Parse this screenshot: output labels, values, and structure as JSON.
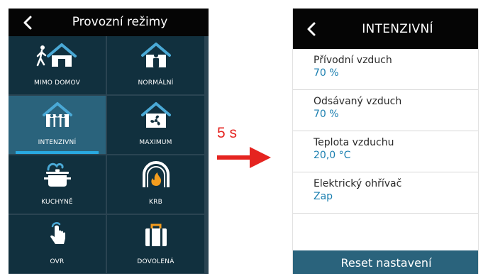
{
  "left_screen": {
    "title": "Provozní režimy",
    "modes": [
      {
        "label": "MIMO DOMOV",
        "icon": "away-from-home-icon"
      },
      {
        "label": "NORMÁLNÍ",
        "icon": "normal-home-icon"
      },
      {
        "label": "INTENZIVNÍ",
        "icon": "intensive-family-icon",
        "selected": true
      },
      {
        "label": "MAXIMUM",
        "icon": "maximum-fan-icon"
      },
      {
        "label": "KUCHYNĚ",
        "icon": "kitchen-pot-icon"
      },
      {
        "label": "KRB",
        "icon": "fireplace-flame-icon"
      },
      {
        "label": "OVR",
        "icon": "touch-hand-icon"
      },
      {
        "label": "DOVOLENÁ",
        "icon": "suitcase-icon"
      }
    ]
  },
  "transition": {
    "delay_label": "5 s",
    "arrow_color": "#e52420"
  },
  "right_screen": {
    "title": "INTENZIVNÍ",
    "settings": [
      {
        "label": "Přívodní vzduch",
        "value": "70 %"
      },
      {
        "label": "Odsávaný vzduch",
        "value": "70 %"
      },
      {
        "label": "Teplota vzduchu",
        "value": "20,0 °C"
      },
      {
        "label": "Elektrický ohřívač",
        "value": "Zap"
      }
    ],
    "reset_label": "Reset nastavení"
  },
  "colors": {
    "header_bg": "#050505",
    "tile_bg": "#11303e",
    "tile_selected_bg": "#2a637c",
    "selection_bar": "#29a9e1",
    "icon_blue": "#4aa9d6",
    "value_blue": "#1b7fb0",
    "button_bg": "#2a637c"
  }
}
